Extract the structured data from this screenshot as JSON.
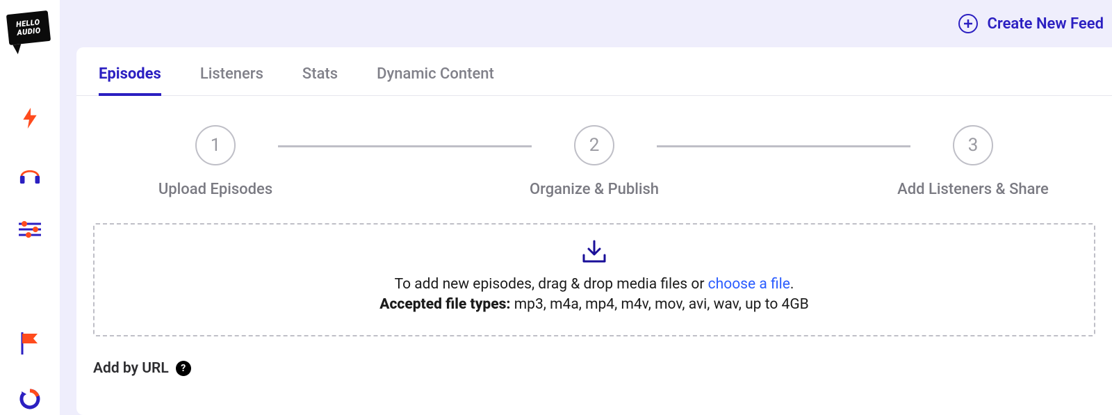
{
  "logo": {
    "line1": "HELLO",
    "line2": "AUDIO"
  },
  "sidebar": {
    "icons": [
      {
        "name": "bolt-icon"
      },
      {
        "name": "headphones-icon"
      },
      {
        "name": "sliders-icon"
      },
      {
        "name": "flag-icon"
      },
      {
        "name": "refresh-icon"
      }
    ]
  },
  "header": {
    "create_feed_label": "Create New Feed"
  },
  "tabs": [
    {
      "label": "Episodes",
      "active": true
    },
    {
      "label": "Listeners",
      "active": false
    },
    {
      "label": "Stats",
      "active": false
    },
    {
      "label": "Dynamic Content",
      "active": false
    }
  ],
  "steps": [
    {
      "number": "1",
      "label": "Upload Episodes"
    },
    {
      "number": "2",
      "label": "Organize & Publish"
    },
    {
      "number": "3",
      "label": "Add Listeners & Share"
    }
  ],
  "dropzone": {
    "prefix": "To add new episodes, drag & drop media files or ",
    "link": "choose a file",
    "suffix": ".",
    "accepted_label": "Accepted file types:",
    "accepted_types": " mp3, m4a, mp4, m4v, mov, avi, wav, up to 4GB"
  },
  "add_by_url": {
    "label": "Add by URL"
  },
  "colors": {
    "primary": "#2b1fc1",
    "accent_orange": "#ff4b1d",
    "muted": "#808089"
  }
}
